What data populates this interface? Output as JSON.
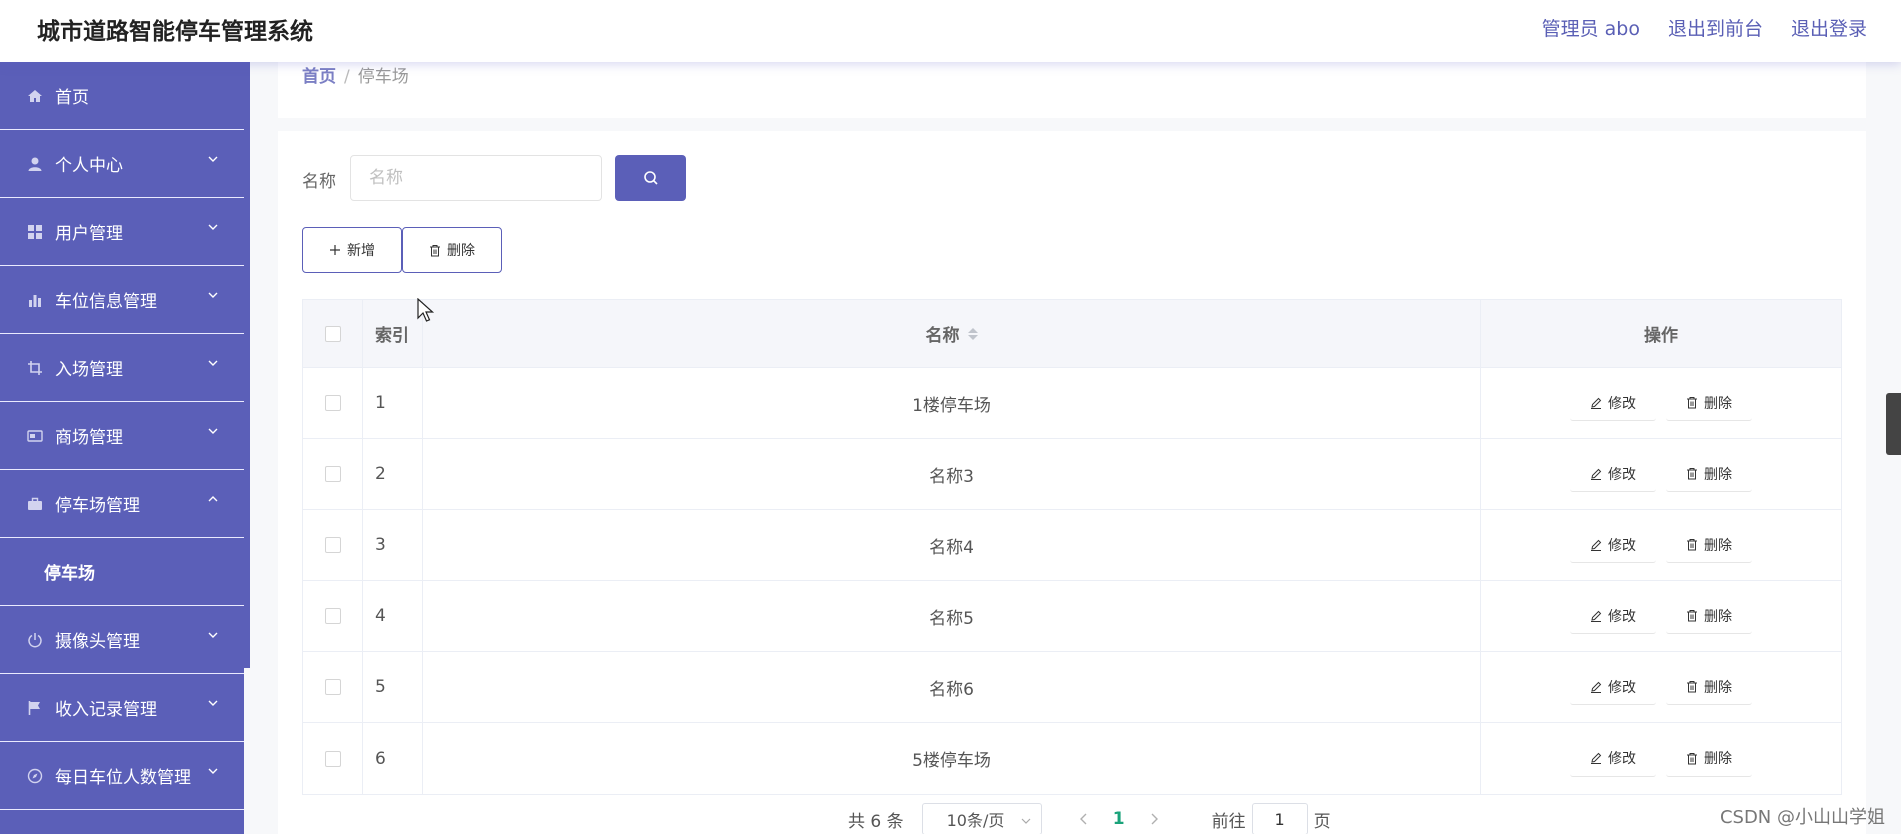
{
  "header": {
    "title": "城市道路智能停车管理系统",
    "links": [
      "管理员 abo",
      "退出到前台",
      "退出登录"
    ]
  },
  "sidebar": {
    "items": [
      {
        "label": "首页",
        "icon": "home-icon",
        "expandable": false
      },
      {
        "label": "个人中心",
        "icon": "user-icon",
        "expandable": true
      },
      {
        "label": "用户管理",
        "icon": "grid-icon",
        "expandable": true
      },
      {
        "label": "车位信息管理",
        "icon": "bar-chart-icon",
        "expandable": true
      },
      {
        "label": "入场管理",
        "icon": "crop-icon",
        "expandable": true
      },
      {
        "label": "商场管理",
        "icon": "card-icon",
        "expandable": true
      },
      {
        "label": "停车场管理",
        "icon": "briefcase-icon",
        "expandable": true,
        "expanded": true
      },
      {
        "label": "摄像头管理",
        "icon": "power-icon",
        "expandable": true
      },
      {
        "label": "收入记录管理",
        "icon": "flag-icon",
        "expandable": true
      },
      {
        "label": "每日车位人数管理",
        "icon": "compass-icon",
        "expandable": true
      }
    ],
    "sub_item": "停车场"
  },
  "breadcrumb": {
    "home": "首页",
    "sep": "/",
    "current": "停车场"
  },
  "search": {
    "label": "名称",
    "placeholder": "名称",
    "value": ""
  },
  "toolbar": {
    "add_label": "新增",
    "delete_label": "删除"
  },
  "table": {
    "headers": {
      "index": "索引",
      "name": "名称",
      "actions": "操作"
    },
    "rows": [
      {
        "index": "1",
        "name": "1楼停车场"
      },
      {
        "index": "2",
        "name": "名称3"
      },
      {
        "index": "3",
        "name": "名称4"
      },
      {
        "index": "4",
        "name": "名称5"
      },
      {
        "index": "5",
        "name": "名称6"
      },
      {
        "index": "6",
        "name": "5楼停车场"
      }
    ],
    "row_actions": {
      "edit": "修改",
      "delete": "删除"
    }
  },
  "pagination": {
    "total": "共 6 条",
    "page_size": "10条/页",
    "current_page": "1",
    "goto_prefix": "前往",
    "goto_value": "1",
    "goto_suffix": "页"
  },
  "watermark": "CSDN @小山山学姐",
  "colors": {
    "accent": "#5b5fb8",
    "page_active": "#1aa37a"
  }
}
